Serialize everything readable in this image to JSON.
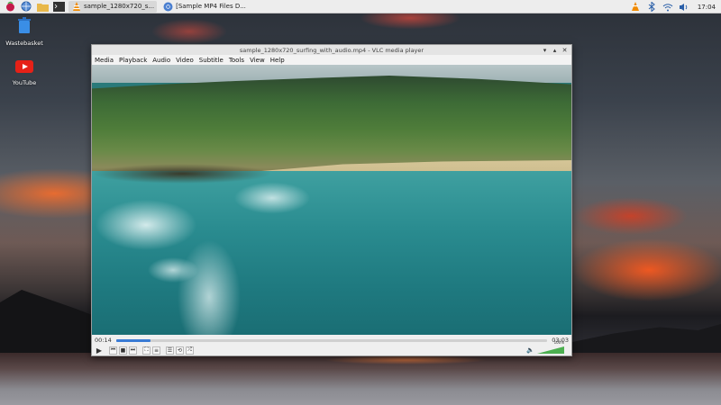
{
  "taskbar": {
    "tasks": [
      {
        "label": "sample_1280x720_s...",
        "icon": "vlc-cone-icon"
      },
      {
        "label": "[Sample MP4 Files D...",
        "icon": "chromium-icon"
      }
    ],
    "clock": "17:04"
  },
  "desktop": {
    "icons": [
      {
        "label": "Wastebasket",
        "icon": "trash-icon"
      },
      {
        "label": "YouTube",
        "icon": "youtube-icon"
      }
    ]
  },
  "vlc": {
    "title": "sample_1280x720_surfing_with_audio.mp4 - VLC media player",
    "menu": [
      "Media",
      "Playback",
      "Audio",
      "Video",
      "Subtitle",
      "Tools",
      "View",
      "Help"
    ],
    "time_current": "00:14",
    "time_total": "03:03",
    "progress": 0.08,
    "volume_label": "100%",
    "volume": 1.0
  },
  "colors": {
    "accent": "#3a7bd5",
    "volume": "#4caf50",
    "vlc_orange": "#f08a00",
    "youtube_red": "#e62117"
  }
}
